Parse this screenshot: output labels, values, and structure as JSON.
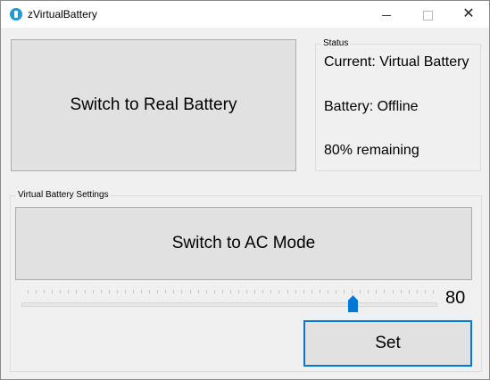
{
  "window": {
    "title": "zVirtualBattery",
    "controls": {
      "minimize": "minimize",
      "maximize": "maximize",
      "close": "✕"
    }
  },
  "main": {
    "switch_battery_label": "Switch to Real Battery"
  },
  "status": {
    "legend": "Status",
    "current": "Current: Virtual Battery",
    "battery": "Battery: Offline",
    "remaining": "80% remaining"
  },
  "settings": {
    "legend": "Virtual Battery Settings",
    "switch_mode_label": "Switch to AC Mode",
    "slider": {
      "value": 80,
      "min": 0,
      "max": 100
    },
    "slider_value_label": "80",
    "set_label": "Set"
  },
  "colors": {
    "accent": "#0078d7",
    "button_bg": "#e1e1e1",
    "window_bg": "#f0f0f0"
  }
}
